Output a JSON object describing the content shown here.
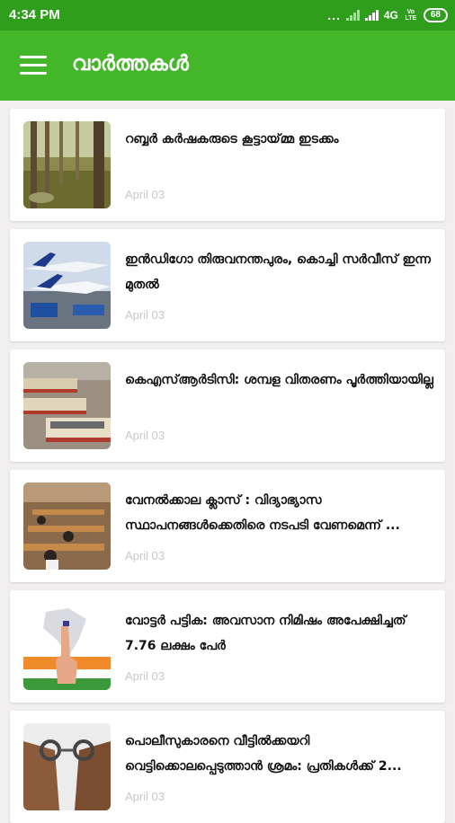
{
  "status_bar": {
    "time": "4:34 PM",
    "network": "4G",
    "volte": "Vo LTE",
    "battery": "68",
    "dots": "..."
  },
  "app_bar": {
    "title": "വാർത്തകൾ",
    "menu_icon": "hamburger-menu-icon"
  },
  "colors": {
    "status_bar": "#2f9e1d",
    "app_bar": "#43b629",
    "background": "#f0eeee",
    "date_text": "#c8c8c8"
  },
  "articles": [
    {
      "headline": "റബ്ബർ കർഷകരുടെ കൂട്ടായ്മ്മ ഇടക്കം",
      "date": "April 03",
      "image": "rubber-plantation-photo"
    },
    {
      "headline": "ഇൻഡിഗോ തിരുവനന്തപുരം, കൊച്ചി സർവീസ് ഇന്ന മുതൽ",
      "date": "April 03",
      "image": "indigo-aircraft-photo"
    },
    {
      "headline": "കെഎസ്ആർടിസി: ശമ്പള വിതരണം പൂർത്തിയായില്ല",
      "date": "April 03",
      "image": "ksrtc-buses-photo"
    },
    {
      "headline": "വേനൽക്കാല ക്ലാസ് : വിദ്യാഭ്യാസ സ്ഥാപനങ്ങൾക്കെതിരെ നടപടി വേണമെന്ന് ...",
      "date": "April 03",
      "image": "exam-hall-photo"
    },
    {
      "headline": "വോട്ടർ പട്ടിക: അവസാന നിമിഷം അപേക്ഷിച്ചത് 7.76 ലക്ഷം പേർ",
      "date": "April 03",
      "image": "voting-finger-india-map-photo"
    },
    {
      "headline": "പൊലീസുകാരനെ വീട്ടിൽക്കയറി വെട്ടിക്കൊലപ്പെടുത്താൻ ശ്രമം: പ്രതികൾക്ക് 2...",
      "date": "April 03",
      "image": "handcuffed-hands-photo"
    }
  ]
}
